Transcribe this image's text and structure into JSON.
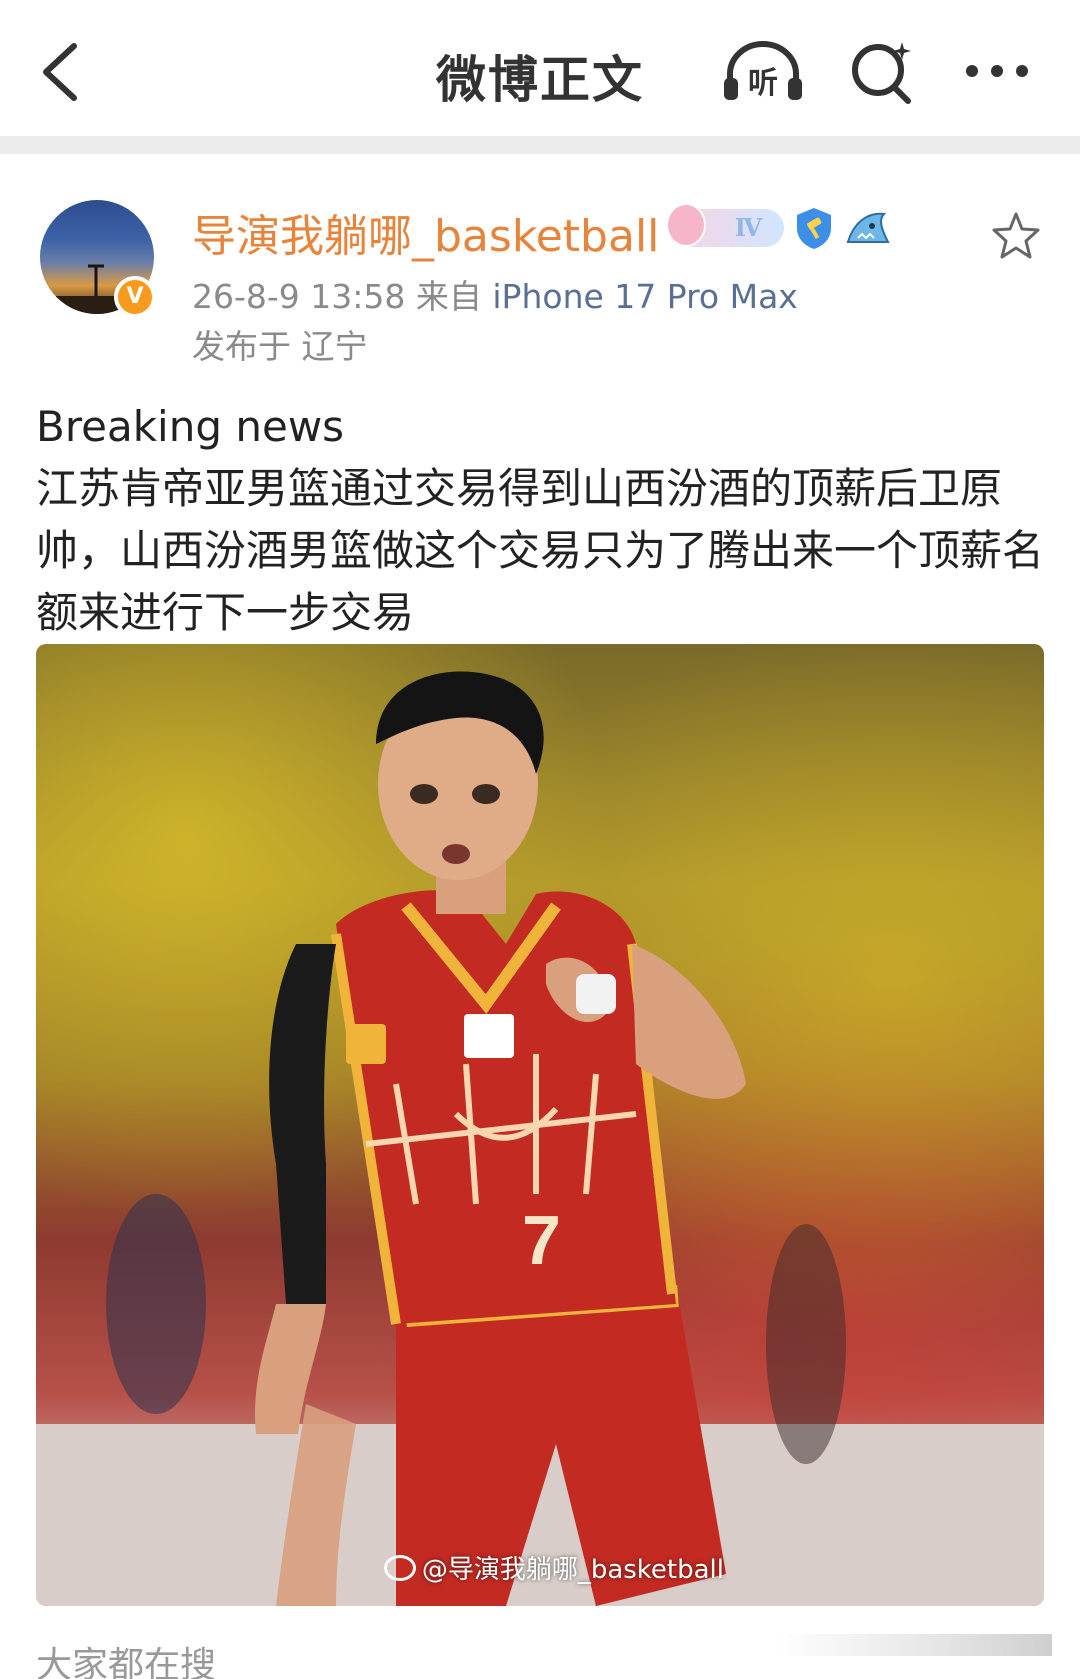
{
  "navbar": {
    "title": "微博正文",
    "listen_label": "听"
  },
  "post": {
    "username": "导演我躺哪_basketball",
    "level_badge": "Ⅳ",
    "verified_mark": "V",
    "timestamp": "26-8-9 13:58",
    "source_prefix": "来自",
    "device": "iPhone 17 Pro Max",
    "location": "发布于 辽宁",
    "text_lines": [
      "Breaking news",
      "江苏肯帝亚男篮通过交易得到山西汾酒的顶薪后卫原帅，山西汾酒男篮做这个交易只为了腾出来一个顶薪名额来进行下一步交易"
    ],
    "photo": {
      "jersey_number": "7",
      "watermark": "@导演我躺哪_basketball"
    }
  },
  "footer": {
    "everyone_search_label": "大家都在搜"
  },
  "colors": {
    "username": "#e8833a",
    "meta": "#8a8a8a",
    "device": "#5a6f95",
    "divider": "#ececec",
    "jersey_red": "#c22a22",
    "jersey_gold": "#f0b43a"
  }
}
